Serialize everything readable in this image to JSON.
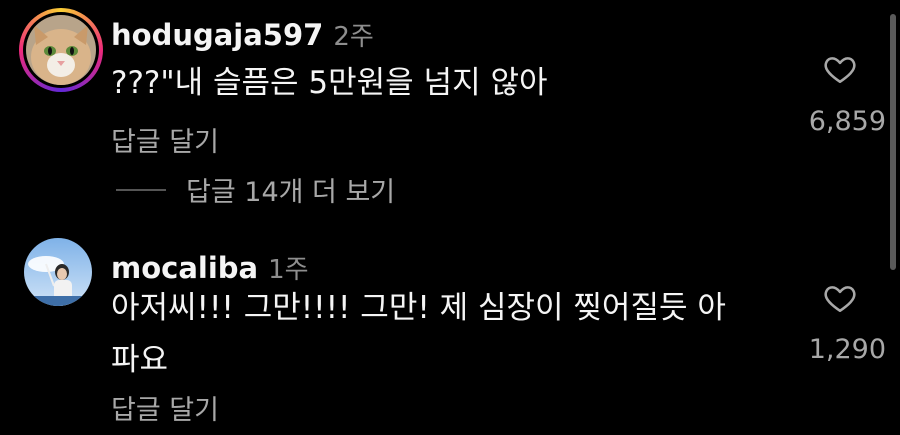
{
  "comments": [
    {
      "username": "hodugaja597",
      "age": "2주",
      "text_lines": [
        "???\"내 슬픔은 5만원을 넘지 않아"
      ],
      "reply_label": "답글 달기",
      "likes": "6,859",
      "view_replies": "답글 14개 더 보기",
      "avatar": "cat-avatar",
      "has_story_ring": true
    },
    {
      "username": "mocaliba",
      "age": "1주",
      "text_lines": [
        "아저씨!!! 그만!!!! 그만! 제 심장이 찢어질듯 아",
        "파요"
      ],
      "reply_label": "답글 달기",
      "likes": "1,290",
      "avatar": "person-sky-avatar",
      "has_story_ring": false
    }
  ],
  "icons": {
    "like": "heart-outline-icon"
  },
  "colors": {
    "background": "#000000",
    "text": "#f5f5f5",
    "muted": "#a8a8a8"
  }
}
